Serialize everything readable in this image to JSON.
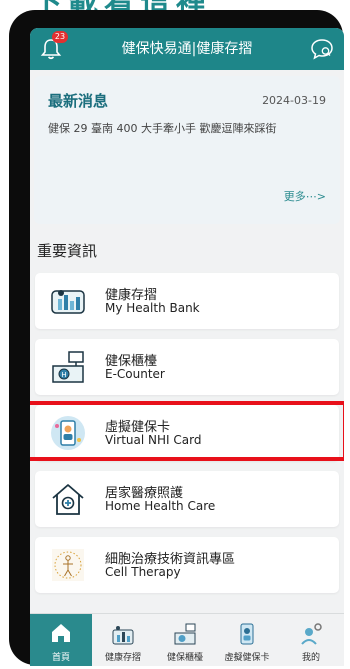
{
  "page_top_text": "下載看這裡",
  "header": {
    "title": "健保快易通|健康存摺",
    "badge_count": "23"
  },
  "news": {
    "title": "最新消息",
    "date": "2024-03-19",
    "text": "健保 29 臺南 400 大手牽小手 歡慶逗陣來踩街",
    "more": "更多⋯>"
  },
  "section_title": "重要資訊",
  "items": [
    {
      "zh": "健康存摺",
      "en": "My Health Bank",
      "icon": "health-bank-icon"
    },
    {
      "zh": "健保櫃檯",
      "en": "E-Counter",
      "icon": "counter-icon"
    },
    {
      "zh": "虛擬健保卡",
      "en": "Virtual NHI Card",
      "icon": "virtual-card-icon"
    },
    {
      "zh": "居家醫療照護",
      "en": "Home Health Care",
      "icon": "home-care-icon"
    },
    {
      "zh": "細胞治療技術資訊專區",
      "en": "Cell Therapy",
      "icon": "cell-therapy-icon"
    }
  ],
  "nav": [
    {
      "label": "首頁",
      "icon": "home-icon",
      "active": true
    },
    {
      "label": "健康存摺",
      "icon": "health-bank-icon"
    },
    {
      "label": "健保櫃檯",
      "icon": "counter-icon"
    },
    {
      "label": "虛擬健保卡",
      "icon": "card-icon"
    },
    {
      "label": "我的",
      "icon": "profile-icon"
    }
  ],
  "colors": {
    "primary": "#1e8689",
    "highlight": "#e8101a",
    "news_bg": "#eef3f6"
  }
}
